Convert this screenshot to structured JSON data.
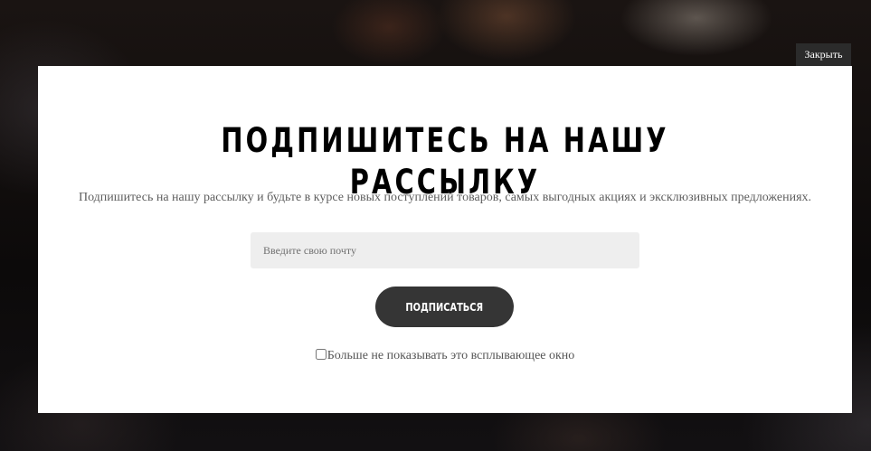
{
  "popup": {
    "close_label": "Закрыть",
    "title": "ПОДПИШИТЕСЬ НА НАШУ РАССЫЛКУ",
    "description": "Подпишитесь на нашу рассылку и будьте в курсе новых поступлений товаров, самых выгодных акциях и эксклюзивных предложениях.",
    "email": {
      "value": "",
      "placeholder": "Введите свою почту"
    },
    "subscribe_label": "ПОДПИСАТЬСЯ",
    "dont_show_label": "Больше не показывать это всплывающее окно",
    "dont_show_checked": false
  },
  "colors": {
    "overlay_background": "#0d0a09",
    "modal_background": "#ffffff",
    "button_background": "#353535",
    "input_background": "#eeeeee",
    "close_background": "#2b2b2b"
  }
}
